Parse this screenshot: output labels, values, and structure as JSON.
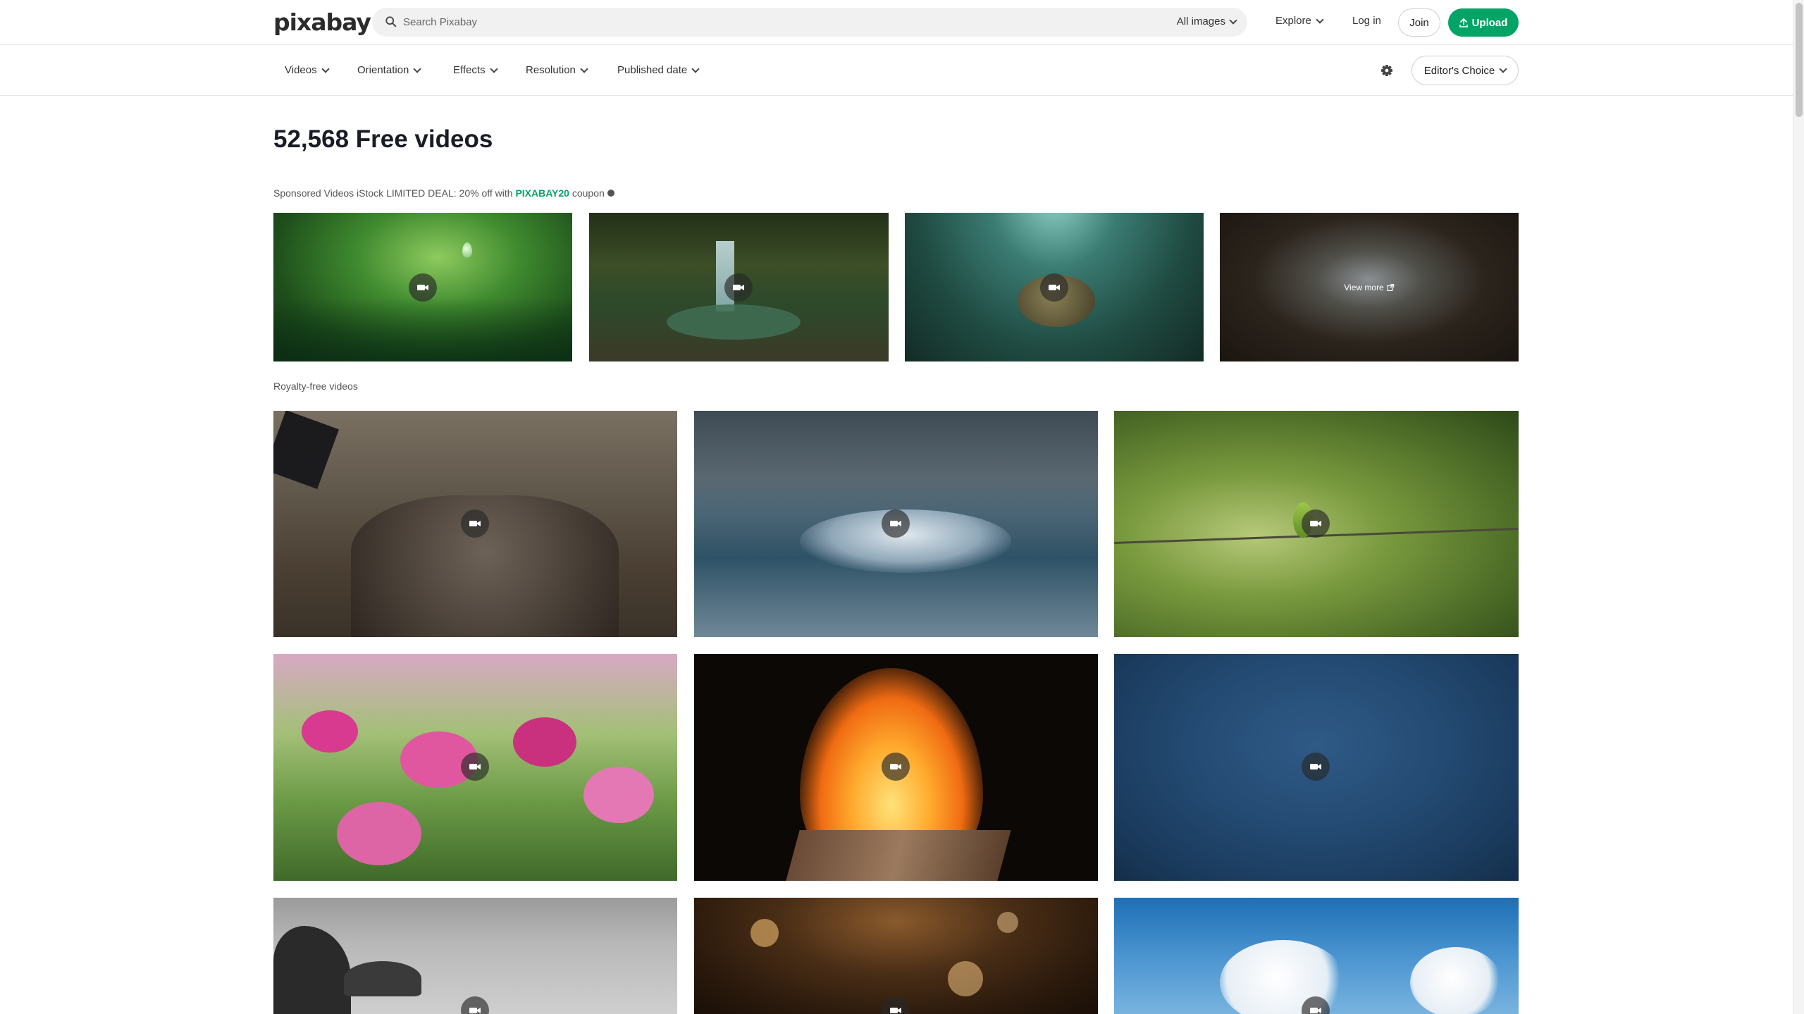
{
  "header": {
    "logo": "pixabay",
    "search_placeholder": "Search Pixabay",
    "search_type": "All images",
    "explore": "Explore",
    "login": "Log in",
    "join": "Join",
    "upload": "Upload"
  },
  "filters": {
    "items": [
      "Videos",
      "Orientation",
      "Effects",
      "Resolution",
      "Published date"
    ],
    "editors_choice": "Editor's Choice"
  },
  "main": {
    "title": "52,568 Free videos",
    "sponsored_prefix": "Sponsored Videos iStock LIMITED DEAL: 20% off with ",
    "sponsored_code": "PIXABAY20",
    "sponsored_suffix": " coupon",
    "view_more": "View more",
    "royalty_label": "Royalty-free videos"
  },
  "colors": {
    "accent": "#00a467",
    "text": "#191b26"
  },
  "icons": {
    "search": "search-icon",
    "chevron": "chevron-down-icon",
    "upload": "upload-icon",
    "settings": "gear-icon",
    "video": "video-camera-icon",
    "external": "external-link-icon",
    "info": "info-icon"
  },
  "sponsored_videos": [
    {
      "subject": "water droplet on leaf"
    },
    {
      "subject": "forest waterfall"
    },
    {
      "subject": "sea turtle underwater"
    },
    {
      "subject": "looking up at tall trees"
    }
  ],
  "videos": [
    {
      "subject": "axe splitting a log"
    },
    {
      "subject": "ocean wave on stormy shore"
    },
    {
      "subject": "bee-eater bird on wire"
    },
    {
      "subject": "pink cosmos flowers"
    },
    {
      "subject": "campfire flames"
    },
    {
      "subject": "rain on dark water"
    },
    {
      "subject": "black and white rocky coast"
    },
    {
      "subject": "golden bokeh lights"
    },
    {
      "subject": "white clouds in blue sky"
    }
  ]
}
